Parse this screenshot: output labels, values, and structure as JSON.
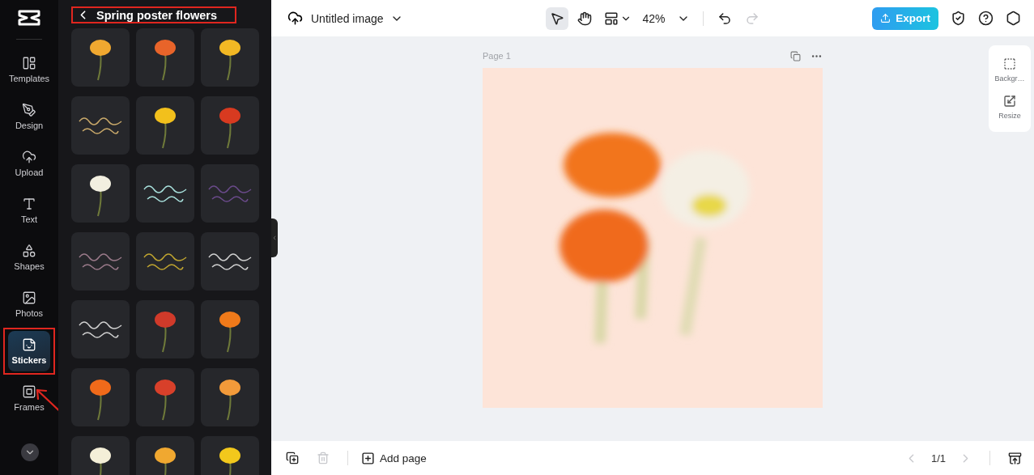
{
  "rail": {
    "items": [
      {
        "label": "Templates",
        "selected": false,
        "annotated": false
      },
      {
        "label": "Design",
        "selected": false,
        "annotated": false
      },
      {
        "label": "Upload",
        "selected": false,
        "annotated": false
      },
      {
        "label": "Text",
        "selected": false,
        "annotated": false
      },
      {
        "label": "Shapes",
        "selected": false,
        "annotated": false
      },
      {
        "label": "Photos",
        "selected": false,
        "annotated": false
      },
      {
        "label": "Stickers",
        "selected": true,
        "annotated": true
      },
      {
        "label": "Frames",
        "selected": false,
        "annotated": false
      }
    ]
  },
  "panel": {
    "title": "Spring poster flowers",
    "annotated": true,
    "stickers": [
      {
        "kind": "flower",
        "color": "#f0a830"
      },
      {
        "kind": "flower",
        "color": "#e8642a"
      },
      {
        "kind": "flower",
        "color": "#f2b824"
      },
      {
        "kind": "lettering",
        "color": "#c9a96a"
      },
      {
        "kind": "flower",
        "color": "#f2c01c"
      },
      {
        "kind": "flower",
        "color": "#d83a20"
      },
      {
        "kind": "flower",
        "color": "#f2efe0"
      },
      {
        "kind": "lettering",
        "color": "#a8e0dc"
      },
      {
        "kind": "lettering",
        "color": "#6a4a8a"
      },
      {
        "kind": "lettering",
        "color": "#9a7a8a"
      },
      {
        "kind": "lettering",
        "color": "#c0a530"
      },
      {
        "kind": "lettering",
        "color": "#d0d0d0"
      },
      {
        "kind": "lettering",
        "color": "#d0d0d0"
      },
      {
        "kind": "flower",
        "color": "#d03a2a"
      },
      {
        "kind": "flower",
        "color": "#f07a1a"
      },
      {
        "kind": "flower",
        "color": "#f06a1a"
      },
      {
        "kind": "flower",
        "color": "#d8402a"
      },
      {
        "kind": "flower",
        "color": "#f29a3a"
      },
      {
        "kind": "flower",
        "color": "#f4efd8"
      },
      {
        "kind": "flower",
        "color": "#f0a830"
      },
      {
        "kind": "flower",
        "color": "#f2c81c"
      }
    ]
  },
  "toolbar": {
    "file_name": "Untitled image",
    "tools": [
      {
        "selected": true
      },
      {
        "selected": false
      }
    ],
    "zoom": "42%",
    "redo_disabled": true,
    "export": "Export"
  },
  "canvas": {
    "page_label": "Page 1"
  },
  "side_panel": {
    "items": [
      {
        "label": "Backgr…"
      },
      {
        "label": "Resize"
      }
    ]
  },
  "bottom_bar": {
    "delete_disabled": true,
    "add_page": "Add page",
    "page_count": "1/1",
    "prev_disabled": true,
    "next_disabled": true
  }
}
